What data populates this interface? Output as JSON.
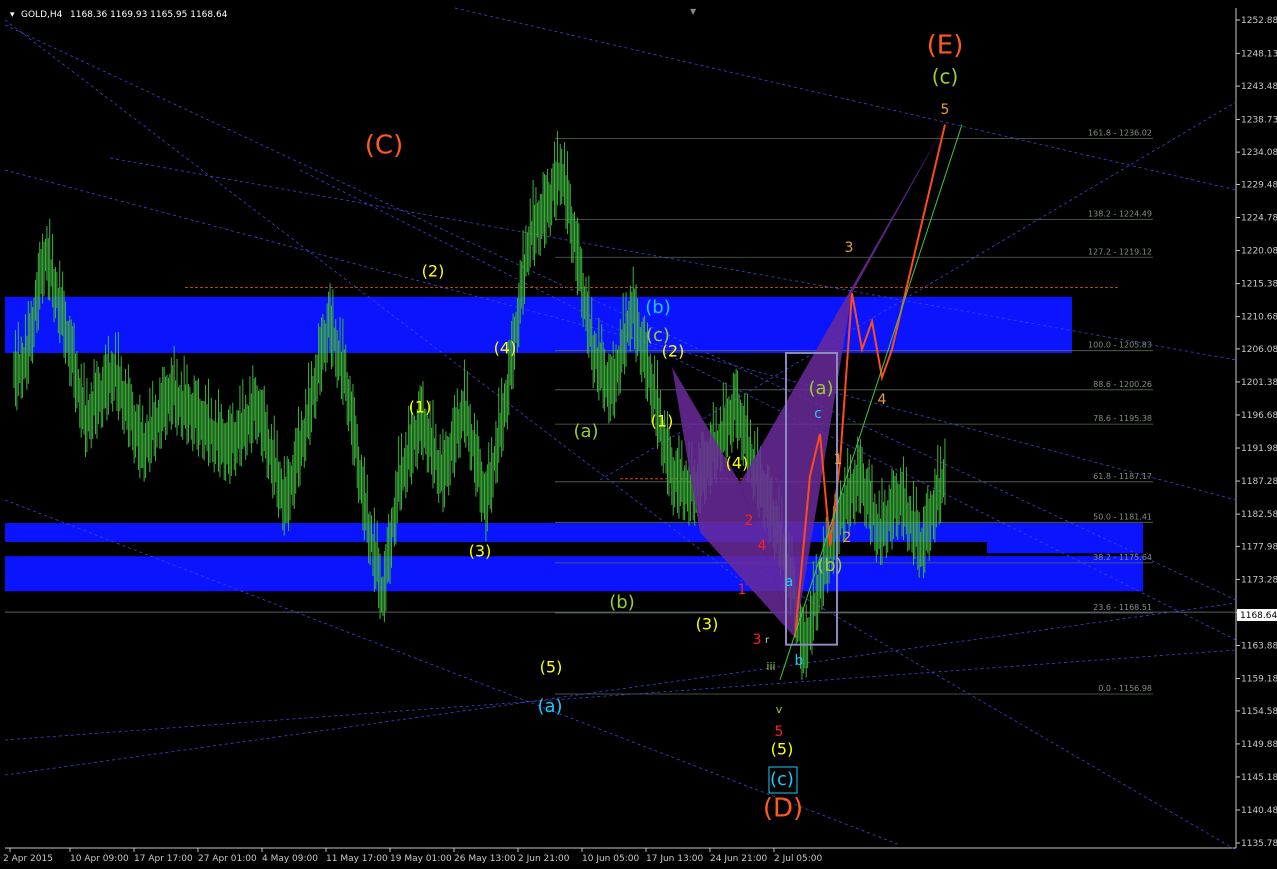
{
  "header": {
    "symbol": "GOLD,H4",
    "ohlc": "1168.36 1169.93 1165.95 1168.64"
  },
  "chart_data": {
    "type": "line",
    "symbol": "GOLD",
    "timeframe": "H4",
    "ylim": [
      1133,
      1254
    ],
    "price_ticks": [
      "1252.88",
      "1248.13",
      "1243.48",
      "1238.73",
      "1234.08",
      "1229.48",
      "1224.78",
      "1220.08",
      "1215.38",
      "1210.68",
      "1206.08",
      "1201.38",
      "1196.68",
      "1191.98",
      "1187.28",
      "1182.58",
      "1177.98",
      "1173.28",
      "1168.58",
      "1163.88",
      "1159.18",
      "1154.58",
      "1149.88",
      "1145.18",
      "1140.48",
      "1135.78"
    ],
    "current_price": "1168.64",
    "x_ticks": [
      "2 Apr 2015",
      "10 Apr 09:00",
      "17 Apr 17:00",
      "27 Apr 01:00",
      "4 May 09:00",
      "11 May 17:00",
      "19 May 01:00",
      "26 May 13:00",
      "2 Jun 21:00",
      "10 Jun 05:00",
      "17 Jun 13:00",
      "24 Jun 21:00",
      "2 Jul 05:00"
    ],
    "fib_levels": [
      {
        "label": "161.8 - 1236.02",
        "price": 1236.02
      },
      {
        "label": "138.2 - 1224.49",
        "price": 1224.49
      },
      {
        "label": "127.2 - 1219.12",
        "price": 1219.12
      },
      {
        "label": "100.0 - 1205.83",
        "price": 1205.83
      },
      {
        "label": "88.6 - 1200.26",
        "price": 1200.26
      },
      {
        "label": "78.6 - 1195.38",
        "price": 1195.38
      },
      {
        "label": "61.8 - 1187.17",
        "price": 1187.17
      },
      {
        "label": "50.0 - 1181.41",
        "price": 1181.41
      },
      {
        "label": "38.2 - 1175.64",
        "price": 1175.64
      },
      {
        "label": "23.6 - 1168.51",
        "price": 1168.51
      },
      {
        "label": "0.0 - 1156.98",
        "price": 1156.98
      }
    ],
    "zones": [
      {
        "name": "upper-resistance-zone",
        "top": 1213.5,
        "bottom": 1205.5,
        "color": "#0a14ff"
      },
      {
        "name": "mid-support-zone",
        "top": 1181.3,
        "bottom": 1177.0,
        "color": "#0a14ff"
      },
      {
        "name": "lower-support-zone",
        "top": 1176.6,
        "bottom": 1171.6,
        "color": "#0a14ff"
      }
    ],
    "price_path": [
      [
        0,
        1202
      ],
      [
        10,
        1206
      ],
      [
        22,
        1220
      ],
      [
        35,
        1210
      ],
      [
        50,
        1196
      ],
      [
        70,
        1203
      ],
      [
        90,
        1192
      ],
      [
        110,
        1200
      ],
      [
        130,
        1196
      ],
      [
        150,
        1192
      ],
      [
        170,
        1198
      ],
      [
        190,
        1184
      ],
      [
        205,
        1196
      ],
      [
        220,
        1210
      ],
      [
        232,
        1202
      ],
      [
        245,
        1184
      ],
      [
        258,
        1171
      ],
      [
        270,
        1188
      ],
      [
        285,
        1196
      ],
      [
        300,
        1188
      ],
      [
        315,
        1198
      ],
      [
        330,
        1184
      ],
      [
        345,
        1200
      ],
      [
        360,
        1222
      ],
      [
        372,
        1226
      ],
      [
        383,
        1232
      ],
      [
        395,
        1218
      ],
      [
        405,
        1206
      ],
      [
        418,
        1200
      ],
      [
        432,
        1212
      ],
      [
        445,
        1202
      ],
      [
        460,
        1188
      ],
      [
        475,
        1186
      ],
      [
        490,
        1192
      ],
      [
        505,
        1198
      ],
      [
        520,
        1188
      ],
      [
        535,
        1180
      ],
      [
        545,
        1172
      ],
      [
        552,
        1163
      ],
      [
        565,
        1174
      ],
      [
        578,
        1183
      ],
      [
        592,
        1188
      ],
      [
        605,
        1180
      ],
      [
        620,
        1185
      ],
      [
        635,
        1178
      ],
      [
        650,
        1188
      ],
      [
        662,
        1202
      ],
      [
        672,
        1203
      ],
      [
        685,
        1190
      ],
      [
        698,
        1176
      ],
      [
        708,
        1171
      ],
      [
        718,
        1177
      ],
      [
        730,
        1184
      ],
      [
        740,
        1188
      ],
      [
        752,
        1178
      ],
      [
        765,
        1171
      ],
      [
        775,
        1165
      ],
      [
        782,
        1159
      ],
      [
        790,
        1166
      ],
      [
        800,
        1164
      ],
      [
        810,
        1182
      ],
      [
        820,
        1194
      ],
      [
        830,
        1178
      ],
      [
        840,
        1190
      ],
      [
        852,
        1214
      ],
      [
        862,
        1206
      ],
      [
        872,
        1210
      ],
      [
        882,
        1202
      ],
      [
        892,
        1206
      ],
      [
        900,
        1214
      ],
      [
        915,
        1222
      ],
      [
        930,
        1232
      ],
      [
        945,
        1238
      ]
    ],
    "wave_labels": [
      {
        "text": "(C)",
        "color": "#ff5a1e",
        "size": 26
      },
      {
        "text": "(E)",
        "color": "#ff5a1e",
        "size": 26
      },
      {
        "text": "(D)",
        "color": "#ff5a1e",
        "size": 26
      },
      {
        "text": "(c)",
        "color": "#9acd32",
        "size": 20
      },
      {
        "text": "5",
        "color": "#e8a040",
        "size": 14
      },
      {
        "text": "3",
        "color": "#e8a040",
        "size": 14
      },
      {
        "text": "4",
        "color": "#e8a040",
        "size": 14
      },
      {
        "text": "2",
        "color": "#e8a040",
        "size": 14
      },
      {
        "text": "1",
        "color": "#e8a040",
        "size": 14
      },
      {
        "text": "(b)",
        "color": "#1ec8ff",
        "size": 18
      },
      {
        "text": "(c)",
        "color": "#9acd32",
        "size": 18
      },
      {
        "text": "(2)",
        "color": "#ffff00",
        "size": 16
      },
      {
        "text": "(2)",
        "color": "#ffff00",
        "size": 16
      },
      {
        "text": "(4)",
        "color": "#ffff00",
        "size": 16
      },
      {
        "text": "(1)",
        "color": "#ffff00",
        "size": 16
      },
      {
        "text": "(1)",
        "color": "#ffff00",
        "size": 16
      },
      {
        "text": "(3)",
        "color": "#ffff00",
        "size": 16
      },
      {
        "text": "(4)",
        "color": "#ffff00",
        "size": 16
      },
      {
        "text": "(3)",
        "color": "#ffff00",
        "size": 16
      },
      {
        "text": "(5)",
        "color": "#ffff00",
        "size": 16
      },
      {
        "text": "(5)",
        "color": "#ffff00",
        "size": 16
      },
      {
        "text": "(a)",
        "color": "#9acd32",
        "size": 18
      },
      {
        "text": "(b)",
        "color": "#9acd32",
        "size": 18
      },
      {
        "text": "(a)",
        "color": "#9acd32",
        "size": 18
      },
      {
        "text": "(b)",
        "color": "#9acd32",
        "size": 18
      },
      {
        "text": "(a)",
        "color": "#1ec8ff",
        "size": 18
      },
      {
        "text": "(c)",
        "color": "#1ec8ff",
        "size": 18
      },
      {
        "text": "2",
        "color": "#ff2020",
        "size": 14
      },
      {
        "text": "4",
        "color": "#ff2020",
        "size": 14
      },
      {
        "text": "1",
        "color": "#ff2020",
        "size": 14
      },
      {
        "text": "3",
        "color": "#ff2020",
        "size": 14
      },
      {
        "text": "5",
        "color": "#ff2020",
        "size": 14
      },
      {
        "text": "a",
        "color": "#1ec8ff",
        "size": 14
      },
      {
        "text": "b",
        "color": "#1ec8ff",
        "size": 14
      },
      {
        "text": "c",
        "color": "#1ec8ff",
        "size": 14
      },
      {
        "text": "iii",
        "color": "#9acd32",
        "size": 11
      },
      {
        "text": "v",
        "color": "#9acd32",
        "size": 11
      },
      {
        "text": "r",
        "color": "#c8c8c8",
        "size": 10
      }
    ],
    "colors": {
      "background": "#000000",
      "candles": "#3cb43c",
      "axis": "#c8c8c8",
      "trendline": "#3c46d2",
      "fib": "#5a6a5a",
      "zone": "#0a14ff",
      "pattern_fill": "#6a2a9a",
      "projection": "#ff4a1a",
      "box": "#8a8ac0"
    }
  }
}
